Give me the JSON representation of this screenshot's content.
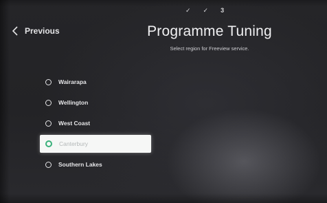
{
  "progress": {
    "steps": [
      "✓",
      "✓",
      "3"
    ]
  },
  "nav": {
    "back_label": "Previous"
  },
  "header": {
    "title": "Programme Tuning",
    "subtitle": "Select region for Freeview service."
  },
  "regions": {
    "items": [
      {
        "label": "Wairarapa",
        "focused": false
      },
      {
        "label": "Wellington",
        "focused": false
      },
      {
        "label": "West Coast",
        "focused": false
      },
      {
        "label": "Canterbury",
        "focused": true
      },
      {
        "label": "Southern Lakes",
        "focused": false
      }
    ]
  },
  "colors": {
    "background": "#232326",
    "focus_background": "#f6f7f6",
    "focus_radio": "#39b07a",
    "text": "#e6e6e8"
  },
  "icons": {
    "back": "chevron-left-icon",
    "radio": "radio-unselected-icon"
  }
}
